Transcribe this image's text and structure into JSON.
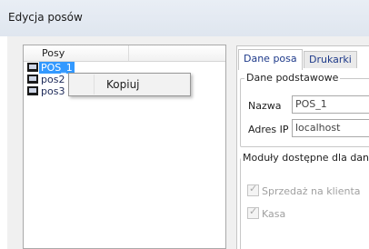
{
  "window": {
    "title": "Edycja posów"
  },
  "list": {
    "header": "Posy",
    "items": [
      {
        "label": "POS_1",
        "selected": true
      },
      {
        "label": "pos2",
        "selected": false
      },
      {
        "label": "pos3",
        "selected": false
      }
    ]
  },
  "context_menu": {
    "items": [
      "Kopiuj"
    ]
  },
  "tabs": [
    {
      "label": "Dane posa",
      "active": true
    },
    {
      "label": "Drukarki",
      "active": false
    }
  ],
  "basic_group": {
    "title": "Dane podstawowe",
    "name_label": "Nazwa",
    "name_value": "POS_1",
    "ip_label": "Adres IP",
    "ip_value": "localhost"
  },
  "modules_group": {
    "title": "Moduły dostępne dla danego posa",
    "checkboxes": [
      {
        "label": "Sprzedaż na klienta",
        "checked": true,
        "enabled": false
      },
      {
        "label": "Kasa",
        "checked": true,
        "enabled": false
      }
    ]
  }
}
